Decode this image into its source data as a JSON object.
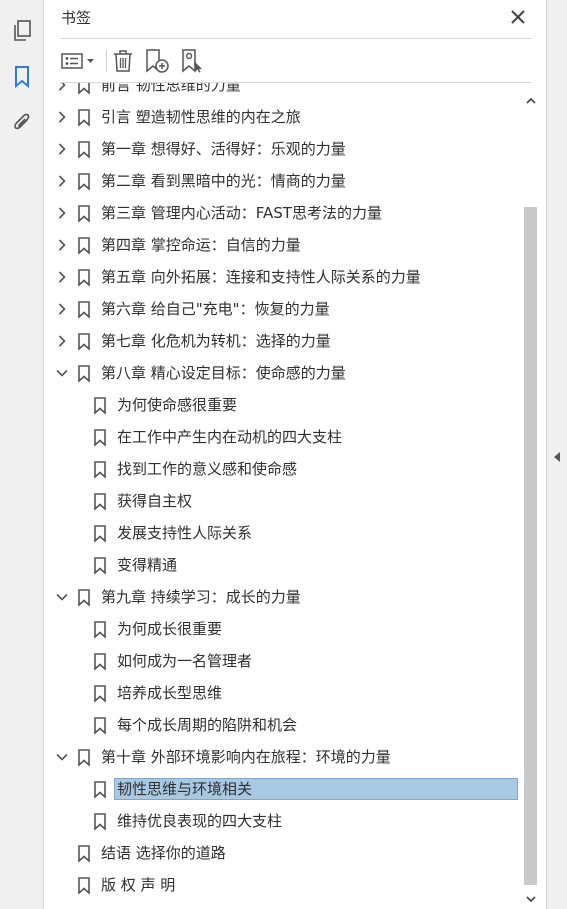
{
  "panel": {
    "title": "书签"
  },
  "toolbar": {
    "icons": [
      "bookmark-options-icon",
      "delete-icon",
      "new-bookmark-icon",
      "bookmark-from-structure-icon"
    ]
  },
  "leftbar": {
    "icons": [
      "pages-icon",
      "bookmarks-icon",
      "attachments-icon"
    ]
  },
  "bookmarks": [
    {
      "label": "前言 韧性思维的力量",
      "level": 0,
      "toggle": "collapsed",
      "partial": true
    },
    {
      "label": "引言 塑造韧性思维的内在之旅",
      "level": 0,
      "toggle": "collapsed"
    },
    {
      "label": "第一章 想得好、活得好：乐观的力量",
      "level": 0,
      "toggle": "collapsed"
    },
    {
      "label": "第二章 看到黑暗中的光：情商的力量",
      "level": 0,
      "toggle": "collapsed"
    },
    {
      "label": "第三章 管理内心活动：FAST思考法的力量",
      "level": 0,
      "toggle": "collapsed"
    },
    {
      "label": "第四章 掌控命运：自信的力量",
      "level": 0,
      "toggle": "collapsed"
    },
    {
      "label": "第五章 向外拓展：连接和支持性人际关系的力量",
      "level": 0,
      "toggle": "collapsed"
    },
    {
      "label": "第六章 给自己\"充电\"：恢复的力量",
      "level": 0,
      "toggle": "collapsed"
    },
    {
      "label": "第七章 化危机为转机：选择的力量",
      "level": 0,
      "toggle": "collapsed"
    },
    {
      "label": "第八章 精心设定目标：使命感的力量",
      "level": 0,
      "toggle": "expanded"
    },
    {
      "label": "为何使命感很重要",
      "level": 1
    },
    {
      "label": "在工作中产生内在动机的四大支柱",
      "level": 1
    },
    {
      "label": "找到工作的意义感和使命感",
      "level": 1
    },
    {
      "label": "获得自主权",
      "level": 1
    },
    {
      "label": "发展支持性人际关系",
      "level": 1
    },
    {
      "label": "变得精通",
      "level": 1
    },
    {
      "label": "第九章 持续学习：成长的力量",
      "level": 0,
      "toggle": "expanded"
    },
    {
      "label": "为何成长很重要",
      "level": 1
    },
    {
      "label": "如何成为一名管理者",
      "level": 1
    },
    {
      "label": "培养成长型思维",
      "level": 1
    },
    {
      "label": "每个成长周期的陷阱和机会",
      "level": 1
    },
    {
      "label": "第十章 外部环境影响内在旅程：环境的力量",
      "level": 0,
      "toggle": "expanded"
    },
    {
      "label": "韧性思维与环境相关",
      "level": 1,
      "selected": true
    },
    {
      "label": "维持优良表现的四大支柱",
      "level": 1
    },
    {
      "label": "结语 选择你的道路",
      "level": 0,
      "toggle": "none"
    },
    {
      "label": "版 权 声 明",
      "level": 0,
      "toggle": "none"
    }
  ],
  "colors": {
    "selection": "#a9c9e3",
    "selection_border": "#7fa7c9",
    "active_icon": "#2d7bd6",
    "icon_gray": "#555555"
  }
}
